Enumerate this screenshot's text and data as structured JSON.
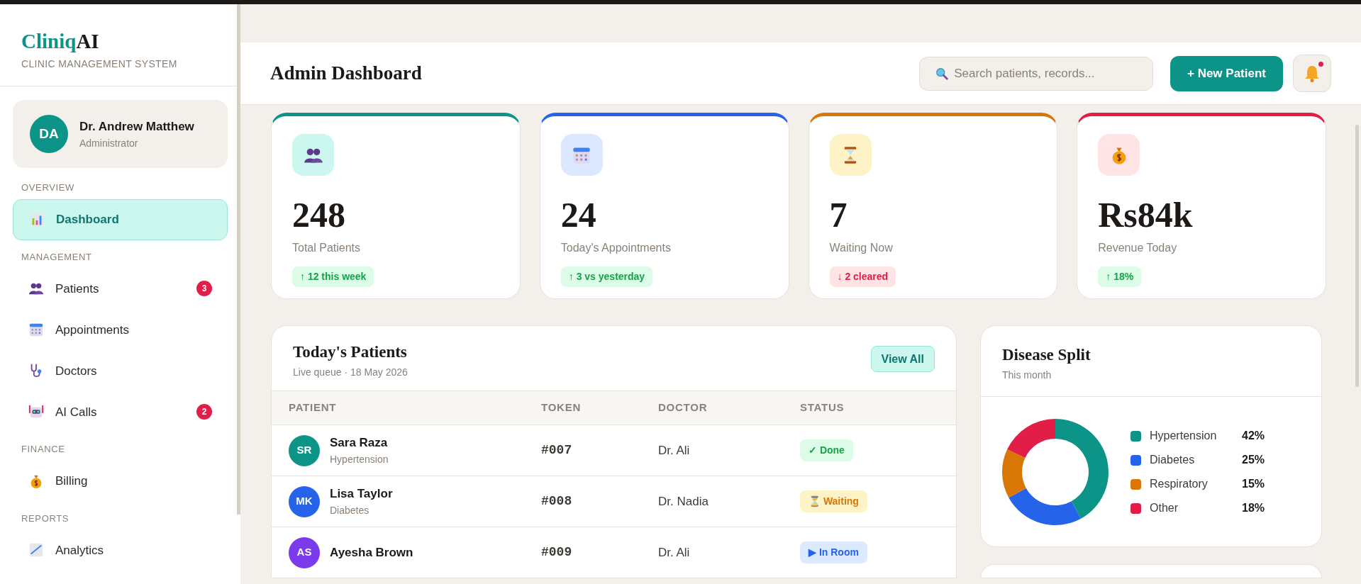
{
  "sidebar": {
    "logo": {
      "brand": "Cliniq",
      "suffix": "AI"
    },
    "tagline": "CLINIC MANAGEMENT SYSTEM",
    "profile": {
      "initials": "DA",
      "name": "Dr. Andrew Matthew",
      "role": "Administrator"
    },
    "sections": [
      {
        "title": "OVERVIEW",
        "items": [
          {
            "kind": "chart",
            "label": "Dashboard",
            "selected": true
          }
        ]
      },
      {
        "title": "MANAGEMENT",
        "items": [
          {
            "kind": "people",
            "label": "Patients",
            "badge": "3",
            "selected": false
          },
          {
            "kind": "calendar",
            "label": "Appointments",
            "selected": false
          },
          {
            "kind": "stethoscope",
            "label": "Doctors",
            "selected": false
          },
          {
            "kind": "robot",
            "label": "AI Calls",
            "badge": "2",
            "selected": false
          }
        ]
      },
      {
        "title": "FINANCE",
        "items": [
          {
            "kind": "moneybag",
            "label": "Billing",
            "selected": false
          }
        ]
      },
      {
        "title": "REPORTS",
        "items": [
          {
            "kind": "analytics",
            "label": "Analytics",
            "selected": false
          }
        ]
      }
    ]
  },
  "header": {
    "title": "Admin Dashboard",
    "search": {
      "placeholder": "Search patients, records..."
    },
    "new_button": "+ New Patient",
    "notifications": {
      "unread": true
    }
  },
  "stats": [
    {
      "kind": "people",
      "color": "#0d9488",
      "value": "248",
      "label": "Total Patients",
      "delta": {
        "text": "↑ 12 this week",
        "kind": "up"
      }
    },
    {
      "kind": "calendar",
      "color": "#2563eb",
      "value": "24",
      "label": "Today's Appointments",
      "delta": {
        "text": "↑ 3 vs yesterday",
        "kind": "up"
      }
    },
    {
      "kind": "hourglass",
      "color": "#d97706",
      "value": "7",
      "label": "Waiting Now",
      "delta": {
        "text": "↓ 2 cleared",
        "kind": "down"
      }
    },
    {
      "kind": "moneybag",
      "color": "#e11d48",
      "value": "Rs84k",
      "label": "Revenue Today",
      "delta": {
        "text": "↑ 18%",
        "kind": "up"
      }
    }
  ],
  "patients": {
    "title": "Today's Patients",
    "subtitle": "Live queue · 18 May 2026",
    "view_all": "View All",
    "columns": [
      "PATIENT",
      "TOKEN",
      "DOCTOR",
      "STATUS"
    ],
    "rows": [
      {
        "initials": "SR",
        "color": "#0d9488",
        "name": "Sara Raza",
        "condition": "Hypertension",
        "token": "#007",
        "doctor": "Dr. Ali",
        "status": {
          "text": "✓ Done",
          "kind": "done"
        }
      },
      {
        "initials": "MK",
        "color": "#2563eb",
        "name": "Lisa Taylor",
        "condition": "Diabetes",
        "token": "#008",
        "doctor": "Dr. Nadia",
        "status": {
          "text": "⏳ Waiting",
          "kind": "waiting"
        }
      },
      {
        "initials": "AS",
        "color": "#7c3aed",
        "name": "Ayesha Brown",
        "token": "#009",
        "doctor": "Dr. Ali",
        "status": {
          "text": "▶ In Room",
          "kind": "in_room"
        }
      }
    ]
  },
  "disease_split": {
    "title": "Disease Split",
    "subtitle": "This month",
    "chart_data": {
      "type": "donut",
      "categories": [
        "Hypertension",
        "Diabetes",
        "Respiratory",
        "Other"
      ],
      "values": [
        42,
        25,
        15,
        18
      ],
      "colors": [
        "#0d9488",
        "#2563eb",
        "#d97706",
        "#e11d48"
      ],
      "value_labels": [
        "42%",
        "25%",
        "15%",
        "18%"
      ]
    }
  }
}
